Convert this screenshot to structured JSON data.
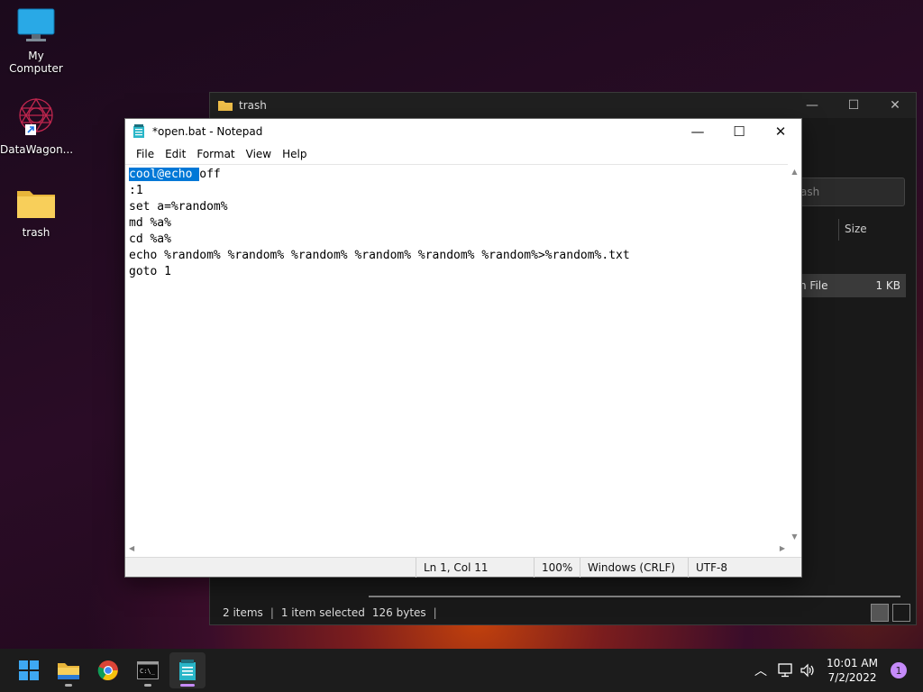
{
  "desktop": {
    "icons": [
      {
        "label": "My Computer"
      },
      {
        "label": "DataWagon..."
      },
      {
        "label": "trash"
      }
    ]
  },
  "explorer": {
    "title": "trash",
    "search_placeholder": "ash",
    "column_size": "Size",
    "file": {
      "type": "h File",
      "size": "1 KB"
    },
    "status": {
      "items": "2 items",
      "selected": "1 item selected",
      "bytes": "126 bytes"
    }
  },
  "notepad": {
    "title": "*open.bat - Notepad",
    "menu": [
      "File",
      "Edit",
      "Format",
      "View",
      "Help"
    ],
    "content": {
      "line1_selected": "cool@echo ",
      "line1_rest": "off",
      "lines": [
        ":1",
        "set a=%random%",
        "md %a%",
        "cd %a%",
        "echo %random% %random% %random% %random% %random% %random%>%random%.txt",
        "goto 1"
      ]
    },
    "status": {
      "position": "Ln 1, Col 11",
      "zoom": "100%",
      "line_ending": "Windows (CRLF)",
      "encoding": "UTF-8"
    }
  },
  "taskbar": {
    "clock_time": "10:01 AM",
    "clock_date": "7/2/2022",
    "notification_count": "1"
  }
}
